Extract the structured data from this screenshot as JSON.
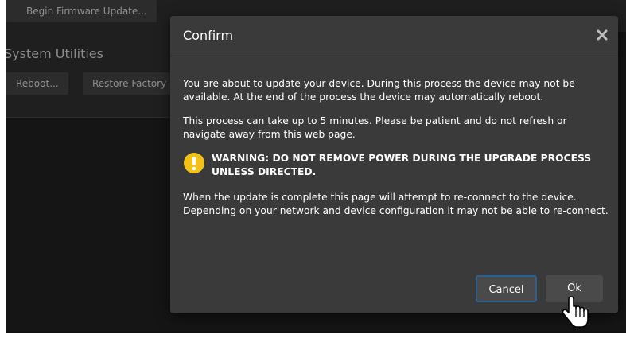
{
  "background": {
    "firmware_button": "Begin Firmware Update...",
    "section_title": "System Utilities",
    "reboot_button": "Reboot...",
    "restore_button": "Restore Factory"
  },
  "dialog": {
    "title": "Confirm",
    "close_icon": "close-icon",
    "paragraph1": "You are about to update your device. During this process the device may not be available. At the end of the process the device may automatically reboot.",
    "paragraph2": "This process can take up to 5 minutes. Please be patient and do not refresh or navigate away from this web page.",
    "warning": "WARNING: DO NOT REMOVE POWER DURING THE UPGRADE PROCESS UNLESS DIRECTED.",
    "paragraph3": "When the update is complete this page will attempt to re-connect to the device. Depending on your network and device configuration it may not be able to re-connect.",
    "cancel_label": "Cancel",
    "ok_label": "Ok"
  },
  "colors": {
    "page_bg": "#151515",
    "dialog_bg": "#3a3a3a",
    "button_bg": "#4a4a4a",
    "focus_border": "#2f5f8f",
    "warning_yellow": "#f2c21b"
  }
}
